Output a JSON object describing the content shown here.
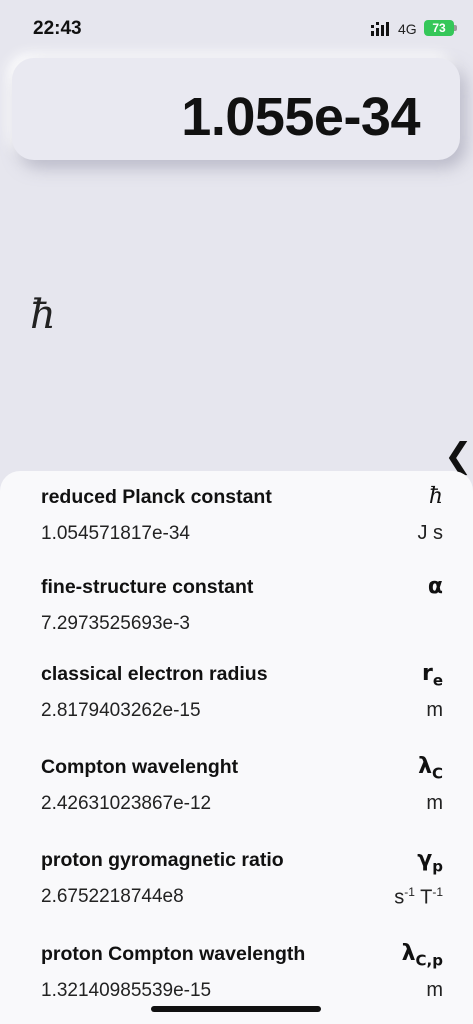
{
  "status": {
    "time": "22:43",
    "network": "4G",
    "battery": "73"
  },
  "display": {
    "value": "1.055e-34"
  },
  "selected_symbol": "ħ",
  "icons": {
    "collapse": "chevron-left-icon"
  },
  "constants": [
    {
      "name": "reduced Planck constant",
      "value": "1.054571817e-34",
      "symbol": "ħ",
      "symbol_sub": "",
      "unit": "J s",
      "unit_sup": ""
    },
    {
      "name": "fine-structure constant",
      "value": "7.2973525693e-3",
      "symbol": "α",
      "symbol_sub": "",
      "unit": "",
      "unit_sup": ""
    },
    {
      "name": "classical electron radius",
      "value": "2.8179403262e-15",
      "symbol": "r",
      "symbol_sub": "e",
      "unit": "m",
      "unit_sup": ""
    },
    {
      "name": "Compton wavelenght",
      "value": "2.42631023867e-12",
      "symbol": "λ",
      "symbol_sub": "C",
      "unit": "m",
      "unit_sup": ""
    },
    {
      "name": "proton gyromagnetic ratio",
      "value": "2.6752218744e8",
      "symbol": "γ",
      "symbol_sub": "p",
      "unit_s": "s",
      "unit_s_sup": "-1",
      "unit_t": "T",
      "unit_t_sup": "-1"
    },
    {
      "name": "proton Compton wavelength",
      "value": "1.32140985539e-15",
      "symbol": "λ",
      "symbol_sub": "C,p",
      "unit": "m",
      "unit_sup": ""
    }
  ]
}
